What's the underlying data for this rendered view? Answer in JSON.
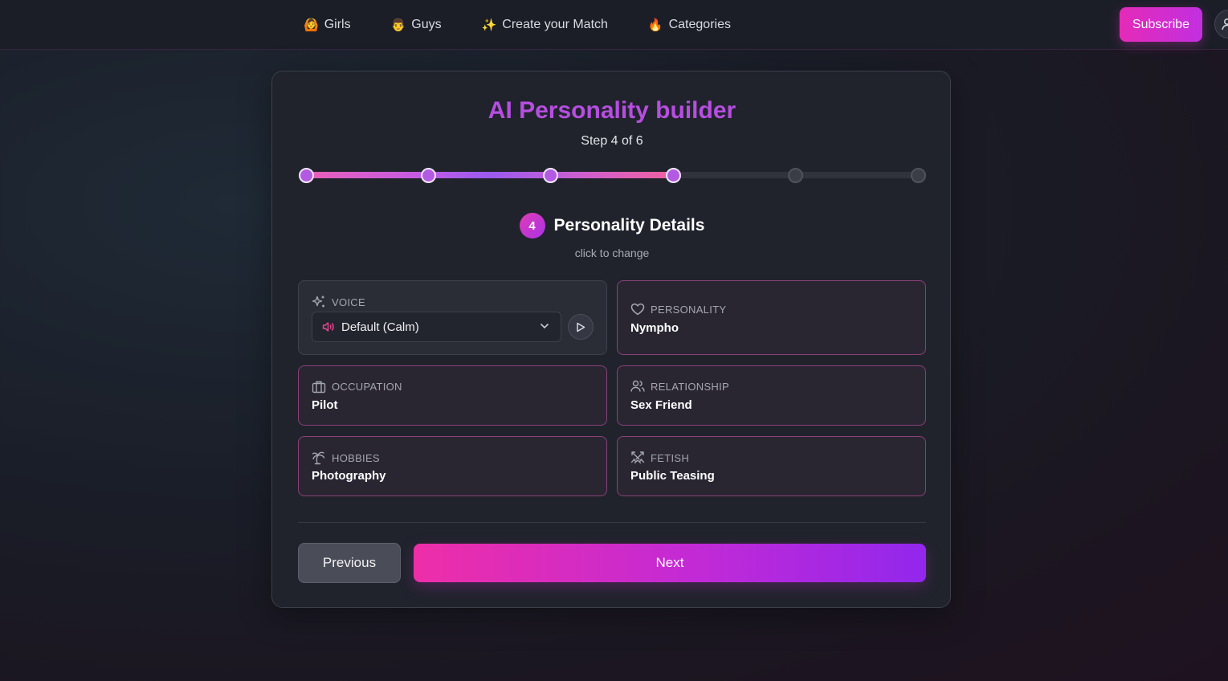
{
  "nav": {
    "items": [
      {
        "emoji": "🙆",
        "label": "Girls"
      },
      {
        "emoji": "👨",
        "label": "Guys"
      },
      {
        "emoji": "✨",
        "label": "Create your Match"
      },
      {
        "emoji": "🔥",
        "label": "Categories"
      }
    ],
    "subscribe_label": "Subscribe"
  },
  "builder": {
    "title": "AI Personality builder",
    "step_text": "Step 4 of 6",
    "current_step": 4,
    "total_steps": 6,
    "section_number": "4",
    "section_title": "Personality Details",
    "hint": "click to change",
    "voice": {
      "label": "VOICE",
      "selected": "Default (Calm)",
      "icon": "sparkles-icon"
    },
    "fields": [
      {
        "key": "personality",
        "label": "PERSONALITY",
        "value": "Nympho",
        "icon": "heart-icon"
      },
      {
        "key": "occupation",
        "label": "OCCUPATION",
        "value": "Pilot",
        "icon": "briefcase-icon"
      },
      {
        "key": "relationship",
        "label": "RELATIONSHIP",
        "value": "Sex Friend",
        "icon": "users-icon"
      },
      {
        "key": "hobbies",
        "label": "HOBBIES",
        "value": "Photography",
        "icon": "palm-tree-icon"
      },
      {
        "key": "fetish",
        "label": "FETISH",
        "value": "Public Teasing",
        "icon": "crossed-swords-icon"
      }
    ],
    "prev_label": "Previous",
    "next_label": "Next"
  },
  "colors": {
    "accent_pink": "#ee2ea8",
    "accent_purple": "#9227ec",
    "title": "#b64ee0"
  }
}
